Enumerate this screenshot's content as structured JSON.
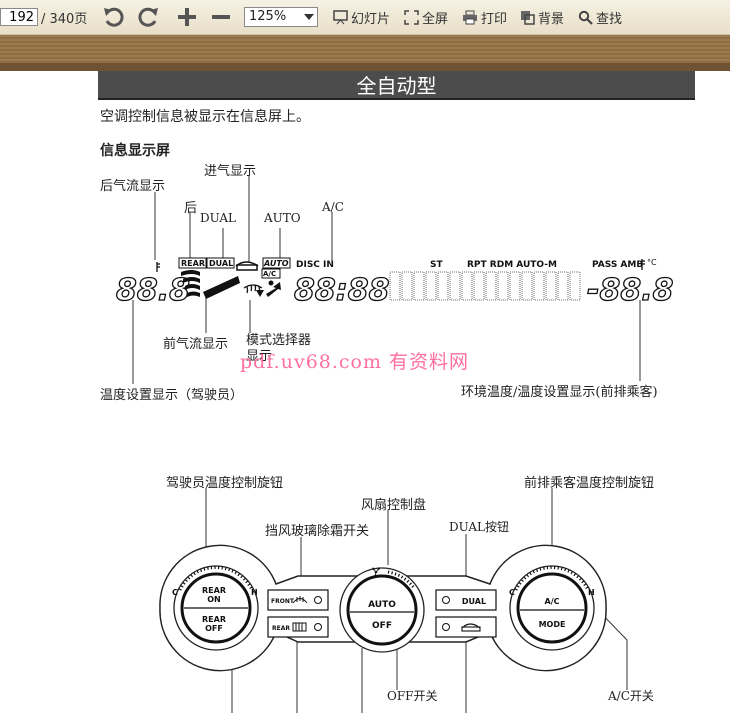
{
  "toolbar": {
    "page_current": "192",
    "page_total": "/ 340页",
    "zoom": "125%",
    "slideshow": "幻灯片",
    "fullscreen": "全屏",
    "print": "打印",
    "background": "背景",
    "search": "查找"
  },
  "doc": {
    "section_title": "全自动型",
    "intro": "空调控制信息被显示在信息屏上。",
    "subheading": "信息显示屏",
    "labels": {
      "rear_airflow": "后气流显示",
      "intake": "进气显示",
      "rear": "后",
      "dual": "DUAL",
      "auto": "AUTO",
      "ac": "A/C",
      "front_airflow": "前气流显示",
      "mode_selector": "模式选择器显示",
      "driver_temp": "温度设置显示（驾驶员）",
      "ambient_temp": "环境温度/温度设置显示(前排乘客)",
      "driver_knob": "驾驶员温度控制旋钮",
      "passenger_knob": "前排乘客温度控制旋钮",
      "fan_dial": "风扇控制盘",
      "defrost_switch": "挡风玻璃除霜开关",
      "dual_button": "DUAL按钮",
      "off_switch": "OFF开关",
      "ac_switch": "A/C开关"
    },
    "lcd": {
      "rear": "REAR",
      "dual": "DUAL",
      "auto": "AUTO",
      "ac": "A/C",
      "disc_in": "DISC IN",
      "st": "ST",
      "rpt_rdm_auto_m": "RPT RDM AUTO-M",
      "pass_amb": "PASS AMB",
      "deg_c": "°C",
      "left_digits": "88.8",
      "clock_digits": "88:88",
      "right_digits": "-88.8"
    },
    "panel": {
      "rear_on_top": "REAR",
      "rear_on_bottom": "ON",
      "rear_off_top": "REAR",
      "rear_off_bottom": "OFF",
      "auto": "AUTO",
      "off": "OFF",
      "ac": "A/C",
      "mode": "MODE",
      "front": "FRONT",
      "rear_defog": "REAR",
      "dual": "DUAL",
      "c": "C",
      "h": "H"
    },
    "watermark": "pdf.uv68.com 有资料网"
  }
}
